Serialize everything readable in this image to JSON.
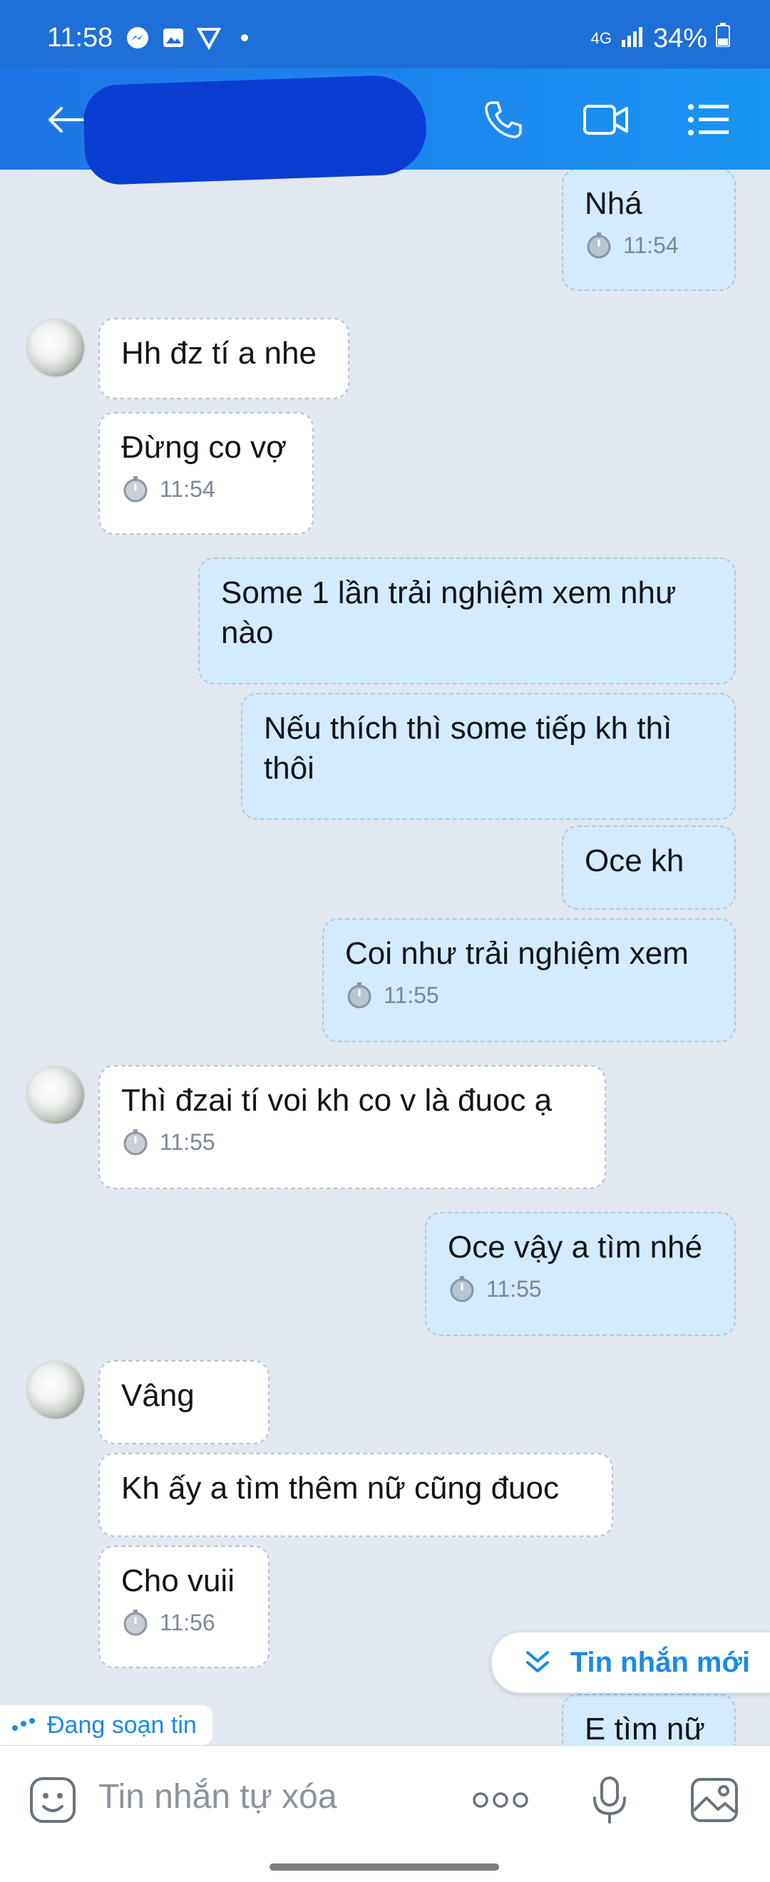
{
  "status_bar": {
    "time": "11:58",
    "network": "4G",
    "battery": "34%"
  },
  "icons": {
    "messenger": "messenger-icon",
    "gallery": "gallery-icon",
    "vpn": "vpn-icon",
    "dot": "notification-dot",
    "back": "back-arrow-icon",
    "call": "phone-icon",
    "video": "video-call-icon",
    "menu": "menu-icon",
    "clock": "timer-clock-icon",
    "chevron": "double-chevron-down-icon",
    "emoji": "emoji-sticker-icon",
    "more": "more-dots-icon",
    "mic": "voice-mic-icon",
    "image": "image-icon"
  },
  "messages": [
    {
      "text": "Nhá",
      "time": "11:54"
    },
    {
      "text": "Hh đz tí a nhe"
    },
    {
      "text": "Đừng co vợ",
      "time": "11:54"
    },
    {
      "text": "Some 1 lần trải nghiệm xem như nào"
    },
    {
      "text": "Nếu thích thì some tiếp kh thì thôi"
    },
    {
      "text": "Oce kh"
    },
    {
      "text": "Coi như trải nghiệm xem",
      "time": "11:55"
    },
    {
      "text": "Thì đzai tí voi kh co v là đuoc ạ",
      "time": "11:55"
    },
    {
      "text": "Oce vậy a tìm nhé",
      "time": "11:55"
    },
    {
      "text": "Vâng"
    },
    {
      "text": "Kh ấy a tìm thêm nữ cũng đuoc"
    },
    {
      "text": "Cho vuii",
      "time": "11:56"
    },
    {
      "text": "E tìm nữ"
    }
  ],
  "new_messages_label": "Tin nhắn mới",
  "typing_label": "Đang soạn tin",
  "composer": {
    "placeholder": "Tin nhắn tự xóa"
  },
  "colors": {
    "header": "#1a8af0",
    "outgoing_bubble": "#d3ebfd",
    "incoming_bubble": "#ffffff",
    "accent": "#1b8ae6"
  }
}
